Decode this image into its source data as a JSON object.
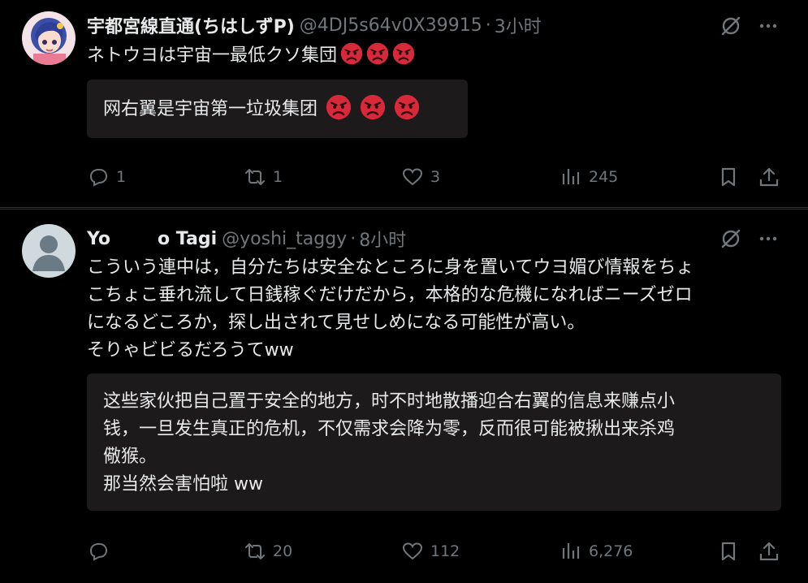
{
  "tweets": [
    {
      "author_name": "宇都宮線直通(ちはしずP)",
      "handle": "@4DJ5s64v0X39915",
      "separator": "·",
      "time": "3小时",
      "text": "ネトウヨは宇宙一最低クソ集団",
      "translation": "网右翼是宇宙第一垃圾集团",
      "reply_count": "1",
      "retweet_count": "1",
      "like_count": "3",
      "view_count": "245"
    },
    {
      "author_name_start": "Yo",
      "author_name_end": "o Tagi",
      "handle": "@yoshi_taggy",
      "separator": "·",
      "time": "8小时",
      "text": "こういう連中は，自分たちは安全なところに身を置いてウヨ媚び情報をちょ\nこちょこ垂れ流して日銭稼ぐだけだから，本格的な危機になればニーズゼロ\nになるどころか，探し出されて見せしめになる可能性が高い。\nそりゃビビるだろうてww",
      "translation": "这些家伙把自己置于安全的地方，时不时地散播迎合右翼的信息来赚点小\n钱，一旦发生真正的危机，不仅需求会降为零，反而很可能被揪出来杀鸡\n儆猴。\n那当然会害怕啦 ww",
      "reply_count": "",
      "retweet_count": "20",
      "like_count": "112",
      "view_count": "6,276"
    }
  ],
  "colors": {
    "background": "#000000",
    "text": "#e7e9ea",
    "muted": "#71767b",
    "translation_bg": "#1d1a1b",
    "divider": "#2f3336",
    "angry_emoji": "#d8293a"
  },
  "icons": [
    "reply-icon",
    "retweet-icon",
    "like-icon",
    "views-icon",
    "bookmark-icon",
    "share-icon",
    "grok-icon",
    "more-icon",
    "angry-face-emoji"
  ]
}
